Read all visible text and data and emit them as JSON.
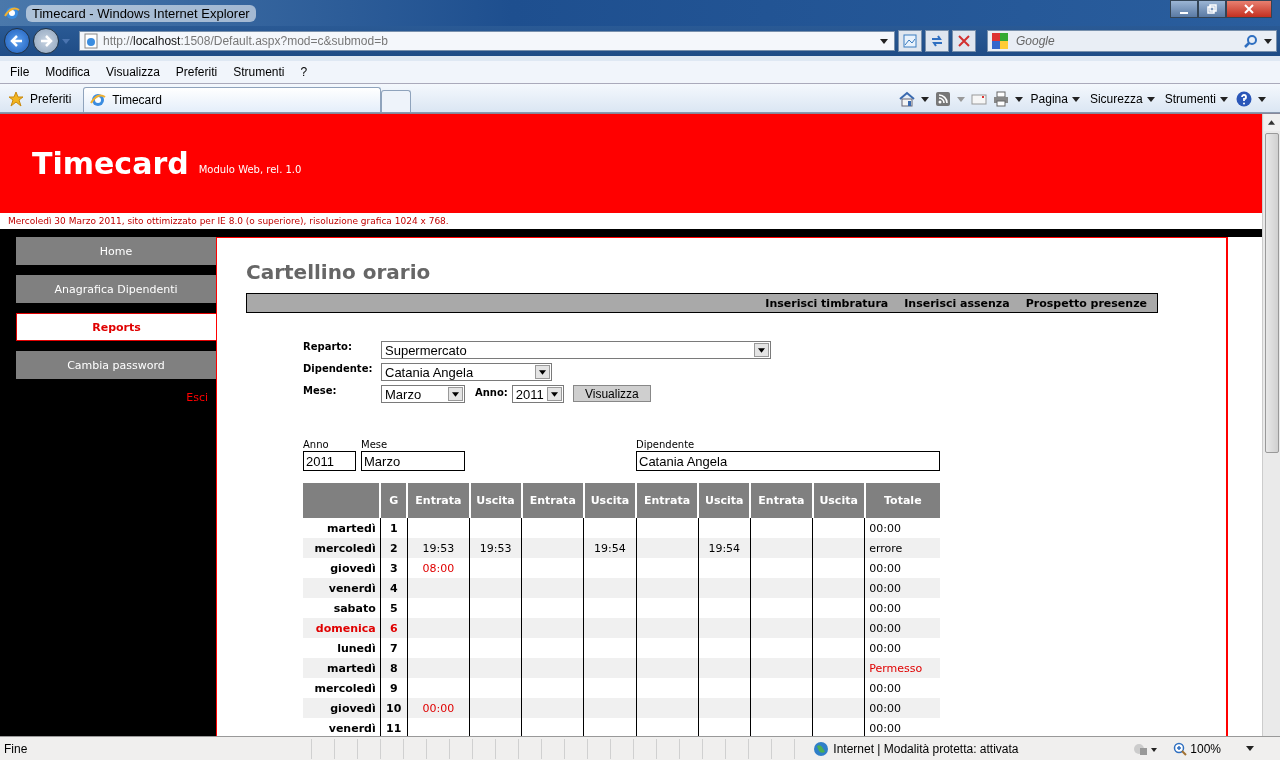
{
  "browser": {
    "title": "Timecard - Windows Internet Explorer",
    "address": "http://**localhost**:1508/Default.aspx?mod=c&submod=b",
    "search_placeholder": "Google",
    "menu": [
      "File",
      "Modifica",
      "Visualizza",
      "Preferiti",
      "Strumenti",
      "?"
    ],
    "favorites": "Preferiti",
    "tabs": [
      {
        "label": "Timecard",
        "selected": true
      }
    ],
    "commands": [
      "Pagina",
      "Sicurezza",
      "Strumenti"
    ]
  },
  "header": {
    "title": "Timecard",
    "subtitle": "Modulo Web, rel. 1.0",
    "notice": "Mercoledì 30 Marzo 2011, sito ottimizzato per IE 8.0 (o superiore), risoluzione grafica 1024 x 768."
  },
  "sidebar": {
    "items": [
      {
        "label": "Home",
        "selected": false
      },
      {
        "label": "Anagrafica Dipendenti",
        "selected": false
      },
      {
        "label": "Reports",
        "selected": true
      },
      {
        "label": "Cambia password",
        "selected": false
      }
    ],
    "logout": "Esci"
  },
  "page": {
    "title": "Cartellino orario",
    "actions": [
      "Inserisci timbratura",
      "Inserisci assenza",
      "Prospetto presenze"
    ]
  },
  "filters": {
    "reparto_label": "Reparto:",
    "reparto": "Supermercato",
    "dipendente_label": "Dipendente:",
    "dipendente": "Catania Angela",
    "mese_label": "Mese:",
    "mese": "Marzo",
    "anno_label": "Anno:",
    "anno": "2011",
    "button": "Visualizza"
  },
  "summary": {
    "anno_label": "Anno",
    "anno": "2011",
    "mese_label": "Mese",
    "mese": "Marzo",
    "dipendente_label": "Dipendente",
    "dipendente": "Catania Angela"
  },
  "table": {
    "columns": [
      "",
      "G",
      "Entrata",
      "Uscita",
      "Entrata",
      "Uscita",
      "Entrata",
      "Uscita",
      "Entrata",
      "Uscita",
      "Totale"
    ],
    "rows": [
      {
        "cells": [
          {
            "text": "martedì",
            "alert": false
          },
          {
            "text": "1",
            "alert": false
          },
          "",
          "",
          "",
          "",
          "",
          "",
          "",
          "",
          {
            "text": "00:00",
            "alert": false
          }
        ]
      },
      {
        "cells": [
          {
            "text": "mercoledì",
            "alert": false
          },
          {
            "text": "2",
            "alert": false
          },
          {
            "text": "19:53",
            "alert": false
          },
          {
            "text": "19:53",
            "alert": false
          },
          "",
          {
            "text": "19:54",
            "alert": false
          },
          "",
          {
            "text": "19:54",
            "alert": false
          },
          "",
          "",
          {
            "text": "errore",
            "alert": false
          }
        ]
      },
      {
        "cells": [
          {
            "text": "giovedì",
            "alert": false
          },
          {
            "text": "3",
            "alert": false
          },
          {
            "text": "08:00",
            "alert": true
          },
          "",
          "",
          "",
          "",
          "",
          "",
          "",
          {
            "text": "00:00",
            "alert": false
          }
        ]
      },
      {
        "cells": [
          {
            "text": "venerdì",
            "alert": false
          },
          {
            "text": "4",
            "alert": false
          },
          "",
          "",
          "",
          "",
          "",
          "",
          "",
          "",
          {
            "text": "00:00",
            "alert": false
          }
        ]
      },
      {
        "cells": [
          {
            "text": "sabato",
            "alert": false
          },
          {
            "text": "5",
            "alert": false
          },
          "",
          "",
          "",
          "",
          "",
          "",
          "",
          "",
          {
            "text": "00:00",
            "alert": false
          }
        ]
      },
      {
        "cells": [
          {
            "text": "domenica",
            "alert": true
          },
          {
            "text": "6",
            "alert": true
          },
          "",
          "",
          "",
          "",
          "",
          "",
          "",
          "",
          {
            "text": "00:00",
            "alert": false
          }
        ]
      },
      {
        "cells": [
          {
            "text": "lunedì",
            "alert": false
          },
          {
            "text": "7",
            "alert": false
          },
          "",
          "",
          "",
          "",
          "",
          "",
          "",
          "",
          {
            "text": "00:00",
            "alert": false
          }
        ]
      },
      {
        "cells": [
          {
            "text": "martedì",
            "alert": false
          },
          {
            "text": "8",
            "alert": false
          },
          "",
          "",
          "",
          "",
          "",
          "",
          "",
          "",
          {
            "text": "Permesso",
            "alert": true
          }
        ]
      },
      {
        "cells": [
          {
            "text": "mercoledì",
            "alert": false
          },
          {
            "text": "9",
            "alert": false
          },
          "",
          "",
          "",
          "",
          "",
          "",
          "",
          "",
          {
            "text": "00:00",
            "alert": false
          }
        ]
      },
      {
        "cells": [
          {
            "text": "giovedì",
            "alert": false
          },
          {
            "text": "10",
            "alert": false
          },
          {
            "text": "00:00",
            "alert": true
          },
          "",
          "",
          "",
          "",
          "",
          "",
          "",
          {
            "text": "00:00",
            "alert": false
          }
        ]
      },
      {
        "cells": [
          {
            "text": "venerdì",
            "alert": false
          },
          {
            "text": "11",
            "alert": false
          },
          "",
          "",
          "",
          "",
          "",
          "",
          "",
          "",
          {
            "text": "00:00",
            "alert": false
          }
        ]
      }
    ]
  },
  "status_bar": {
    "text": "Fine",
    "zone": "Internet | Modalità protetta: attivata",
    "zoom": "100%"
  }
}
